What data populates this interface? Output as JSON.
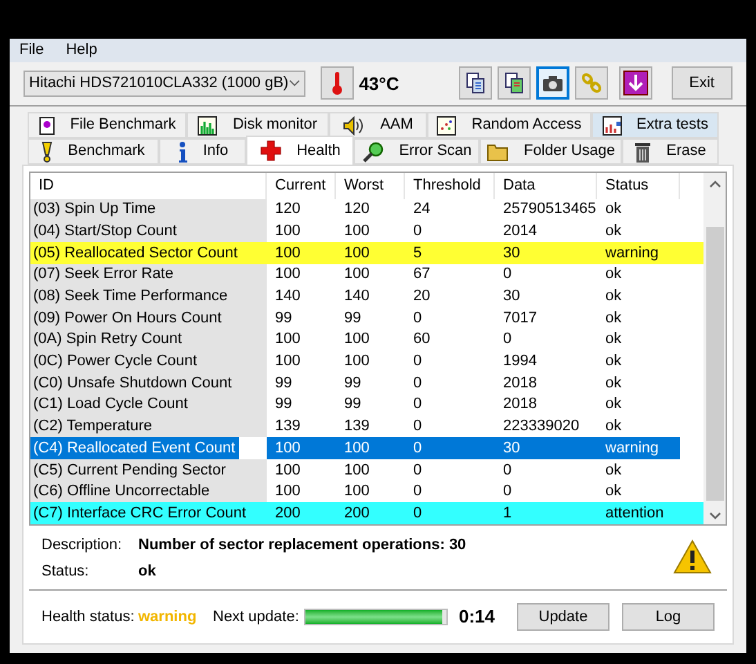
{
  "menu": [
    "File",
    "Help"
  ],
  "drive": {
    "value": "Hitachi HDS721010CLA332 (1000 gB)"
  },
  "temperature": "43°C",
  "toolbar": [
    {
      "kind": "copy",
      "selected": false
    },
    {
      "kind": "copy-green",
      "selected": false
    },
    {
      "kind": "camera",
      "selected": true
    },
    {
      "kind": "chain",
      "selected": false
    },
    {
      "kind": "download",
      "selected": false
    }
  ],
  "exit_button": "Exit",
  "tabs_back": [
    {
      "label": "File Benchmark",
      "hovered": false
    },
    {
      "label": "Disk monitor",
      "hovered": false
    },
    {
      "label": "AAM",
      "hovered": false
    },
    {
      "label": "Random Access",
      "hovered": false
    },
    {
      "label": "Extra tests",
      "hovered": true
    }
  ],
  "tabs_front": [
    {
      "label": "Benchmark",
      "selected": false
    },
    {
      "label": "Info",
      "selected": false
    },
    {
      "label": "Health",
      "selected": true
    },
    {
      "label": "Error Scan",
      "selected": false
    },
    {
      "label": "Folder Usage",
      "selected": false
    },
    {
      "label": "Erase",
      "selected": false
    }
  ],
  "table": {
    "columns": [
      "ID",
      "Current",
      "Worst",
      "Threshold",
      "Data",
      "Status"
    ],
    "rows": [
      {
        "cells": [
          "(03) Spin Up Time",
          "120",
          "120",
          "24",
          "25790513465",
          "ok"
        ],
        "selected": false
      },
      {
        "cells": [
          "(04) Start/Stop Count",
          "100",
          "100",
          "0",
          "2014",
          "ok"
        ],
        "selected": false
      },
      {
        "cells": [
          "(05) Reallocated Sector Count",
          "100",
          "100",
          "5",
          "30",
          "warning"
        ],
        "selected": false,
        "color": "#ffff33"
      },
      {
        "cells": [
          "(07) Seek Error Rate",
          "100",
          "100",
          "67",
          "0",
          "ok"
        ],
        "selected": false
      },
      {
        "cells": [
          "(08) Seek Time Performance",
          "140",
          "140",
          "20",
          "30",
          "ok"
        ],
        "selected": false
      },
      {
        "cells": [
          "(09) Power On Hours Count",
          "99",
          "99",
          "0",
          "7017",
          "ok"
        ],
        "selected": false
      },
      {
        "cells": [
          "(0A) Spin Retry Count",
          "100",
          "100",
          "60",
          "0",
          "ok"
        ],
        "selected": false
      },
      {
        "cells": [
          "(0C) Power Cycle Count",
          "100",
          "100",
          "0",
          "1994",
          "ok"
        ],
        "selected": false
      },
      {
        "cells": [
          "(C0) Unsafe Shutdown Count",
          "99",
          "99",
          "0",
          "2018",
          "ok"
        ],
        "selected": false
      },
      {
        "cells": [
          "(C1) Load Cycle Count",
          "99",
          "99",
          "0",
          "2018",
          "ok"
        ],
        "selected": false
      },
      {
        "cells": [
          "(C2) Temperature",
          "139",
          "139",
          "0",
          "223339020",
          "ok"
        ],
        "selected": false
      },
      {
        "cells": [
          "(C4) Reallocated Event Count",
          "100",
          "100",
          "0",
          "30",
          "warning"
        ],
        "selected": true
      },
      {
        "cells": [
          "(C5) Current Pending Sector",
          "100",
          "100",
          "0",
          "0",
          "ok"
        ],
        "selected": false
      },
      {
        "cells": [
          "(C6) Offline Uncorrectable",
          "100",
          "100",
          "0",
          "0",
          "ok"
        ],
        "selected": false
      },
      {
        "cells": [
          "(C7) Interface CRC Error Count",
          "200",
          "200",
          "0",
          "1",
          "attention"
        ],
        "selected": false,
        "color": "#33ffff"
      }
    ]
  },
  "description": {
    "label": "Description:",
    "value": "Number of sector replacement operations: 30"
  },
  "status": {
    "label": "Status:",
    "value": "ok"
  },
  "health_status": {
    "label": "Health status:",
    "value": "warning"
  },
  "next_update": {
    "label": "Next update:",
    "level": 0.97,
    "reading": "0:14"
  },
  "buttons": [
    "Update",
    "Log"
  ]
}
